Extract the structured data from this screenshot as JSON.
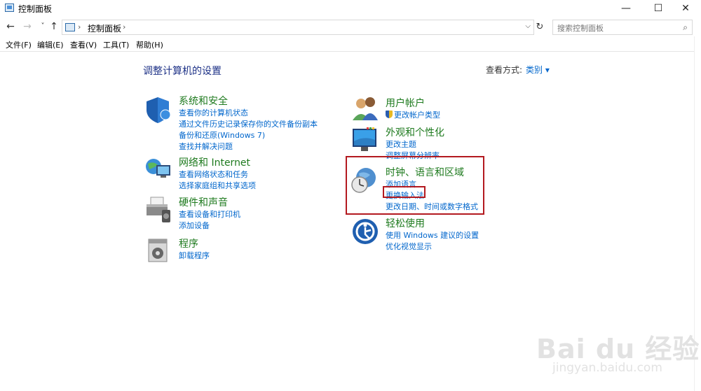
{
  "window": {
    "title": "控制面板",
    "minimize": "—",
    "maximize": "☐",
    "close": "✕"
  },
  "nav": {
    "back": "←",
    "forward": "→",
    "recent": "˅",
    "up": "↑",
    "refresh": "↻"
  },
  "address": {
    "sep1": "›",
    "path": "控制面板",
    "sep2": "›",
    "dropdown": "⌵"
  },
  "search": {
    "placeholder": "搜索控制面板",
    "icon": "⌕"
  },
  "menu": [
    "文件(F)",
    "编辑(E)",
    "查看(V)",
    "工具(T)",
    "帮助(H)"
  ],
  "main": {
    "heading": "调整计算机的设置",
    "view_by_label": "查看方式:",
    "view_by_value": "类别 ▾"
  },
  "categories_left": [
    {
      "title": "系统和安全",
      "icon": "shield-icon",
      "links": [
        "查看你的计算机状态",
        "通过文件历史记录保存你的文件备份副本",
        "备份和还原(Windows 7)",
        "查找并解决问题"
      ]
    },
    {
      "title": "网络和 Internet",
      "icon": "network-globe-icon",
      "links": [
        "查看网络状态和任务",
        "选择家庭组和共享选项"
      ]
    },
    {
      "title": "硬件和声音",
      "icon": "printer-icon",
      "links": [
        "查看设备和打印机",
        "添加设备"
      ]
    },
    {
      "title": "程序",
      "icon": "programs-icon",
      "links": [
        "卸载程序"
      ]
    }
  ],
  "categories_right": [
    {
      "title": "用户帐户",
      "icon": "users-icon",
      "links": [
        "更改帐户类型"
      ]
    },
    {
      "title": "外观和个性化",
      "icon": "monitor-icon",
      "links": [
        "更改主题",
        "调整屏幕分辨率"
      ]
    },
    {
      "title": "时钟、语言和区域",
      "icon": "clock-globe-icon",
      "links": [
        "添加语言",
        "更换输入法",
        "更改日期、时间或数字格式"
      ]
    },
    {
      "title": "轻松使用",
      "icon": "accessibility-icon",
      "links": [
        "使用 Windows 建议的设置",
        "优化视觉显示"
      ]
    }
  ],
  "watermark": {
    "brand": "Bai du 经验",
    "url": "jingyan.baidu.com"
  },
  "colors": {
    "link": "#0066cc",
    "category_title": "#1e7a1e",
    "heading": "#1e3287",
    "highlight": "#b3191f"
  }
}
